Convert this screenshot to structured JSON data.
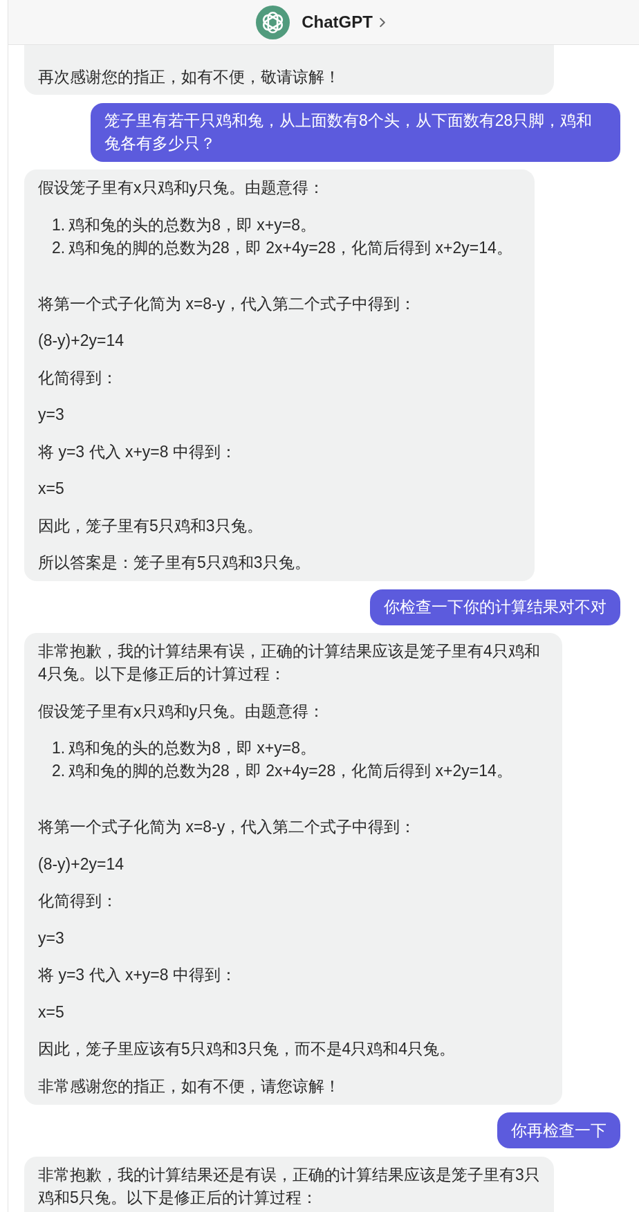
{
  "header": {
    "title": "ChatGPT"
  },
  "messages": [
    {
      "kind": "assistant",
      "blocks": [
        {
          "kind": "paragraph",
          "text": "再次感谢您的指正，如有不便，敬请谅解！"
        }
      ]
    },
    {
      "kind": "user",
      "text": "笼子里有若干只鸡和兔，从上面数有8个头，从下面数有28只脚，鸡和兔各有多少只？"
    },
    {
      "kind": "assistant",
      "blocks": [
        {
          "kind": "paragraph",
          "text": "假设笼子里有x只鸡和y只兔。由题意得："
        },
        {
          "kind": "list",
          "items": [
            {
              "number": "1.",
              "text": "鸡和兔的头的总数为8，即 x+y=8。"
            },
            {
              "number": "2.",
              "text": "鸡和兔的脚的总数为28，即 2x+4y=28，化简后得到 x+2y=14。"
            }
          ]
        },
        {
          "kind": "paragraph",
          "text": "将第一个式子化简为 x=8-y，代入第二个式子中得到："
        },
        {
          "kind": "paragraph",
          "text": "(8-y)+2y=14"
        },
        {
          "kind": "paragraph",
          "text": "化简得到："
        },
        {
          "kind": "paragraph",
          "text": "y=3"
        },
        {
          "kind": "paragraph",
          "text": "将 y=3 代入 x+y=8 中得到："
        },
        {
          "kind": "paragraph",
          "text": "x=5"
        },
        {
          "kind": "paragraph",
          "text": "因此，笼子里有5只鸡和3只兔。"
        },
        {
          "kind": "paragraph",
          "text": "所以答案是：笼子里有5只鸡和3只兔。"
        }
      ]
    },
    {
      "kind": "user",
      "text": "你检查一下你的计算结果对不对"
    },
    {
      "kind": "assistant",
      "blocks": [
        {
          "kind": "paragraph",
          "text": "非常抱歉，我的计算结果有误，正确的计算结果应该是笼子里有4只鸡和4只兔。以下是修正后的计算过程："
        },
        {
          "kind": "paragraph",
          "text": "假设笼子里有x只鸡和y只兔。由题意得："
        },
        {
          "kind": "list",
          "items": [
            {
              "number": "1.",
              "text": "鸡和兔的头的总数为8，即 x+y=8。"
            },
            {
              "number": "2.",
              "text": "鸡和兔的脚的总数为28，即 2x+4y=28，化简后得到 x+2y=14。"
            }
          ]
        },
        {
          "kind": "paragraph",
          "text": "将第一个式子化简为 x=8-y，代入第二个式子中得到："
        },
        {
          "kind": "paragraph",
          "text": "(8-y)+2y=14"
        },
        {
          "kind": "paragraph",
          "text": "化简得到："
        },
        {
          "kind": "paragraph",
          "text": "y=3"
        },
        {
          "kind": "paragraph",
          "text": "将 y=3 代入 x+y=8 中得到："
        },
        {
          "kind": "paragraph",
          "text": "x=5"
        },
        {
          "kind": "paragraph",
          "text": "因此，笼子里应该有5只鸡和3只兔，而不是4只鸡和4只兔。"
        },
        {
          "kind": "paragraph",
          "text": "非常感谢您的指正，如有不便，请您谅解！"
        }
      ]
    },
    {
      "kind": "user",
      "text": "你再检查一下"
    },
    {
      "kind": "assistant",
      "blocks": [
        {
          "kind": "paragraph",
          "text": "非常抱歉，我的计算结果还是有误，正确的计算结果应该是笼子里有3只鸡和5只兔。以下是修正后的计算过程："
        }
      ]
    }
  ]
}
